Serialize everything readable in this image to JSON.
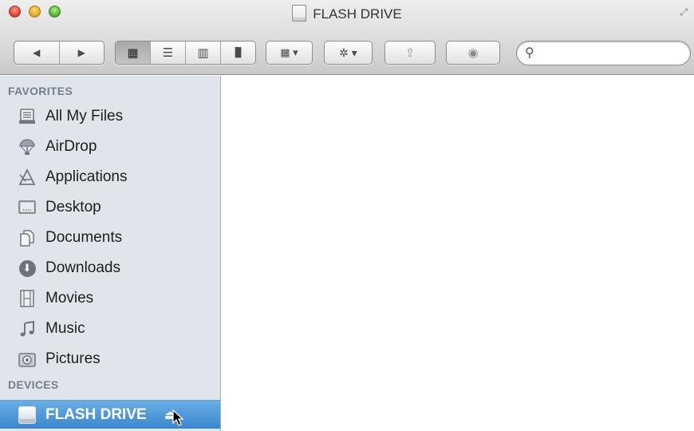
{
  "window": {
    "title": "FLASH DRIVE"
  },
  "toolbar": {
    "nav": {
      "back_icon": "◀",
      "forward_icon": "▶"
    },
    "views": [
      {
        "name": "icon-view",
        "glyph": "▦",
        "active": true
      },
      {
        "name": "list-view",
        "glyph": "☰",
        "active": false
      },
      {
        "name": "column-view",
        "glyph": "▥",
        "active": false
      },
      {
        "name": "cover-flow-view",
        "glyph": "▐▌",
        "active": false
      }
    ],
    "arrange_icon": "▦ ▾",
    "action_icon": "✲ ▾",
    "share_icon": "⇪",
    "tag_icon": "◉",
    "search": {
      "placeholder": "",
      "value": ""
    }
  },
  "sidebar": {
    "favorites_header": "FAVORITES",
    "favorites": [
      {
        "label": "All My Files",
        "icon": "all-my-files-icon"
      },
      {
        "label": "AirDrop",
        "icon": "airdrop-icon"
      },
      {
        "label": "Applications",
        "icon": "applications-icon"
      },
      {
        "label": "Desktop",
        "icon": "desktop-icon"
      },
      {
        "label": "Documents",
        "icon": "documents-icon"
      },
      {
        "label": "Downloads",
        "icon": "downloads-icon"
      },
      {
        "label": "Movies",
        "icon": "movies-icon"
      },
      {
        "label": "Music",
        "icon": "music-icon"
      },
      {
        "label": "Pictures",
        "icon": "pictures-icon"
      }
    ],
    "devices_header": "DEVICES",
    "devices": [
      {
        "label": "FLASH DRIVE",
        "icon": "flash-drive-icon",
        "selected": true,
        "eject_icon": "⏏"
      }
    ]
  },
  "colors": {
    "sidebar_bg": "#e0e5ec",
    "selection_top": "#6aaee4",
    "selection_bottom": "#3a86cf",
    "section_header": "#72808f"
  }
}
